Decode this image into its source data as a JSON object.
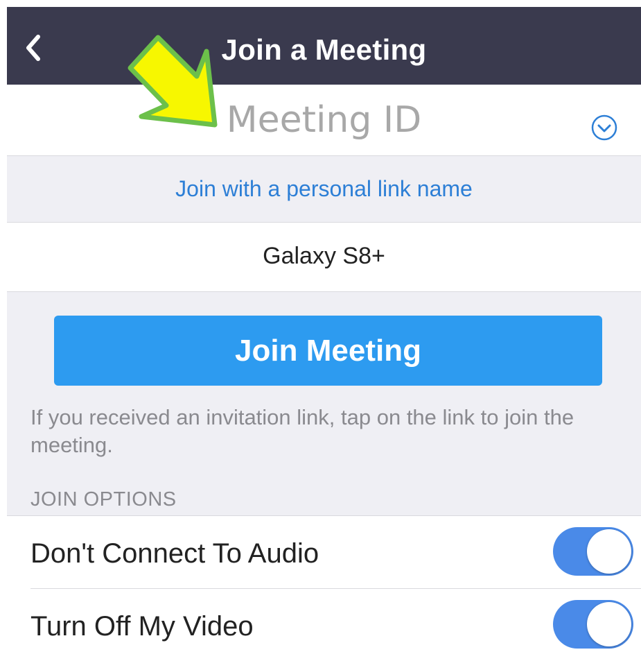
{
  "header": {
    "title": "Join a Meeting",
    "back_icon": "chevron-left-icon"
  },
  "meeting_id": {
    "placeholder": "Meeting ID",
    "value": "",
    "dropdown_icon": "chevron-down-circle-icon"
  },
  "personal_link": {
    "label": "Join with a personal link name"
  },
  "display_name": {
    "value": "Galaxy S8+"
  },
  "join_button": {
    "label": "Join Meeting"
  },
  "hint": {
    "text": "If you received an invitation link, tap on the link to join the meeting."
  },
  "join_options": {
    "section_label": "JOIN OPTIONS",
    "options": [
      {
        "label": "Don't Connect To Audio",
        "enabled": true
      },
      {
        "label": "Turn Off My Video",
        "enabled": true
      }
    ]
  },
  "colors": {
    "header_bg": "#3a3a4e",
    "accent_blue": "#2d9bf0",
    "link_blue": "#2d7fd6",
    "toggle_on": "#4a8ae8",
    "annotation_arrow": "#f7f700"
  }
}
